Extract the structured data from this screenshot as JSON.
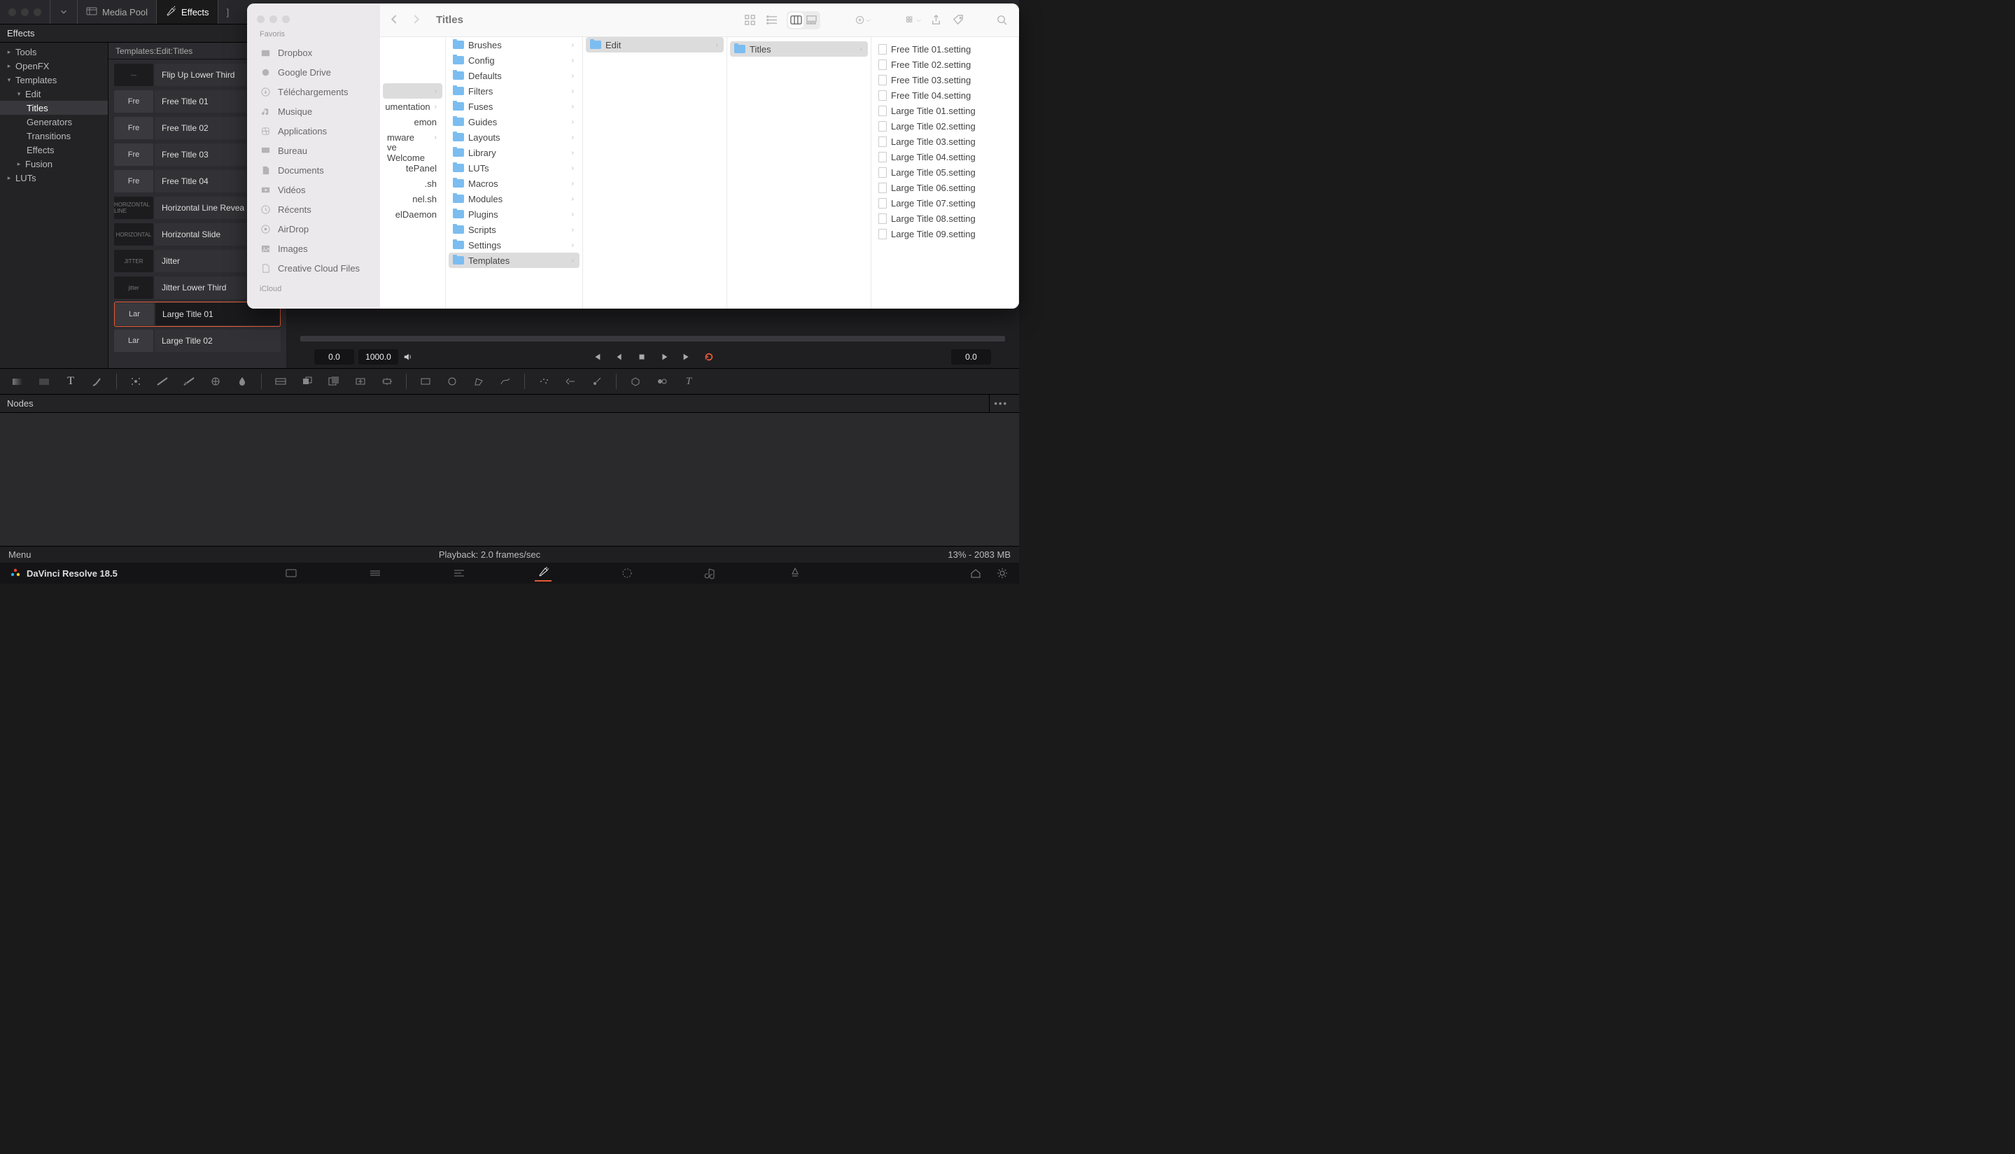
{
  "app": {
    "name": "DaVinci Resolve 18.5",
    "menu_label": "Menu",
    "playback_status": "Playback: 2.0 frames/sec",
    "cpu_mem": "13% - 2083 MB"
  },
  "topbar": {
    "media_pool": "Media Pool",
    "effects": "Effects"
  },
  "effects_panel_title": "Effects",
  "tree": [
    {
      "label": "Tools",
      "level": 0,
      "disc": ">"
    },
    {
      "label": "OpenFX",
      "level": 0,
      "disc": ">"
    },
    {
      "label": "Templates",
      "level": 0,
      "disc": "v"
    },
    {
      "label": "Edit",
      "level": 1,
      "disc": "v"
    },
    {
      "label": "Titles",
      "level": 2,
      "sel": true
    },
    {
      "label": "Generators",
      "level": 2
    },
    {
      "label": "Transitions",
      "level": 2
    },
    {
      "label": "Effects",
      "level": 2
    },
    {
      "label": "Fusion",
      "level": 1,
      "disc": ">"
    },
    {
      "label": "LUTs",
      "level": 0,
      "disc": ">"
    }
  ],
  "titles_breadcrumb": "Templates:Edit:Titles",
  "title_cards": [
    {
      "thumb": "—",
      "thumb_cls": "",
      "label": "Flip Up Lower Third"
    },
    {
      "thumb": "Fre",
      "thumb_cls": "f",
      "label": "Free Title 01"
    },
    {
      "thumb": "Fre",
      "thumb_cls": "f",
      "label": "Free Title 02"
    },
    {
      "thumb": "Fre",
      "thumb_cls": "f",
      "label": "Free Title 03"
    },
    {
      "thumb": "Fre",
      "thumb_cls": "f",
      "label": "Free Title 04"
    },
    {
      "thumb": "HORIZONTAL LINE",
      "thumb_cls": "",
      "label": "Horizontal Line Revea"
    },
    {
      "thumb": "HORIZONTAL",
      "thumb_cls": "",
      "label": "Horizontal Slide"
    },
    {
      "thumb": "JITTER",
      "thumb_cls": "",
      "label": "Jitter"
    },
    {
      "thumb": "jitter",
      "thumb_cls": "",
      "label": "Jitter Lower Third"
    },
    {
      "thumb": "Lar",
      "thumb_cls": "f",
      "label": "Large Title 01",
      "sel": true
    },
    {
      "thumb": "Lar",
      "thumb_cls": "f",
      "label": "Large Title 02"
    }
  ],
  "transport": {
    "tc_in": "0.0",
    "tc_range": "1000.0",
    "tc_out": "0.0"
  },
  "nodes_label": "Nodes",
  "finder": {
    "title": "Titles",
    "sidebar_header": "Favoris",
    "sidebar_icloud": "iCloud",
    "sidebar": [
      {
        "label": "Dropbox",
        "ico": "box"
      },
      {
        "label": "Google Drive",
        "ico": "disk"
      },
      {
        "label": "Téléchargements",
        "ico": "download"
      },
      {
        "label": "Musique",
        "ico": "music"
      },
      {
        "label": "Applications",
        "ico": "apps"
      },
      {
        "label": "Bureau",
        "ico": "desktop"
      },
      {
        "label": "Documents",
        "ico": "doc"
      },
      {
        "label": "Vidéos",
        "ico": "video"
      },
      {
        "label": "Récents",
        "ico": "clock"
      },
      {
        "label": "AirDrop",
        "ico": "airdrop"
      },
      {
        "label": "Images",
        "ico": "image"
      },
      {
        "label": "Creative Cloud Files",
        "ico": "file"
      }
    ],
    "col0": [
      {
        "label": "",
        "folder": true,
        "sel": true
      },
      {
        "label": "umentation",
        "folder": true
      },
      {
        "label": "emon",
        "folder": false
      },
      {
        "label": "mware",
        "folder": true
      },
      {
        "label": "ve Welcome",
        "folder": false
      },
      {
        "label": "tePanel",
        "folder": false
      },
      {
        "label": ".sh",
        "folder": false,
        "file": true
      },
      {
        "label": "nel.sh",
        "folder": false,
        "file": true
      },
      {
        "label": "elDaemon",
        "folder": false
      }
    ],
    "col1": [
      {
        "label": "Brushes",
        "folder": true
      },
      {
        "label": "Config",
        "folder": true
      },
      {
        "label": "Defaults",
        "folder": true
      },
      {
        "label": "Filters",
        "folder": true
      },
      {
        "label": "Fuses",
        "folder": true
      },
      {
        "label": "Guides",
        "folder": true
      },
      {
        "label": "Layouts",
        "folder": true
      },
      {
        "label": "Library",
        "folder": true
      },
      {
        "label": "LUTs",
        "folder": true
      },
      {
        "label": "Macros",
        "folder": true
      },
      {
        "label": "Modules",
        "folder": true
      },
      {
        "label": "Plugins",
        "folder": true
      },
      {
        "label": "Scripts",
        "folder": true
      },
      {
        "label": "Settings",
        "folder": true
      },
      {
        "label": "Templates",
        "folder": true,
        "sel": true
      }
    ],
    "col2": [
      {
        "label": "Edit",
        "folder": true,
        "sel": true
      }
    ],
    "col3": [
      {
        "label": "Titles",
        "folder": true,
        "sel": true
      }
    ],
    "col4": [
      {
        "label": "Free Title 01.setting"
      },
      {
        "label": "Free Title 02.setting"
      },
      {
        "label": "Free Title 03.setting"
      },
      {
        "label": "Free Title 04.setting"
      },
      {
        "label": "Large Title 01.setting"
      },
      {
        "label": "Large Title 02.setting"
      },
      {
        "label": "Large Title 03.setting"
      },
      {
        "label": "Large Title 04.setting"
      },
      {
        "label": "Large Title 05.setting"
      },
      {
        "label": "Large Title 06.setting"
      },
      {
        "label": "Large Title 07.setting"
      },
      {
        "label": "Large Title 08.setting"
      },
      {
        "label": "Large Title 09.setting"
      }
    ]
  }
}
